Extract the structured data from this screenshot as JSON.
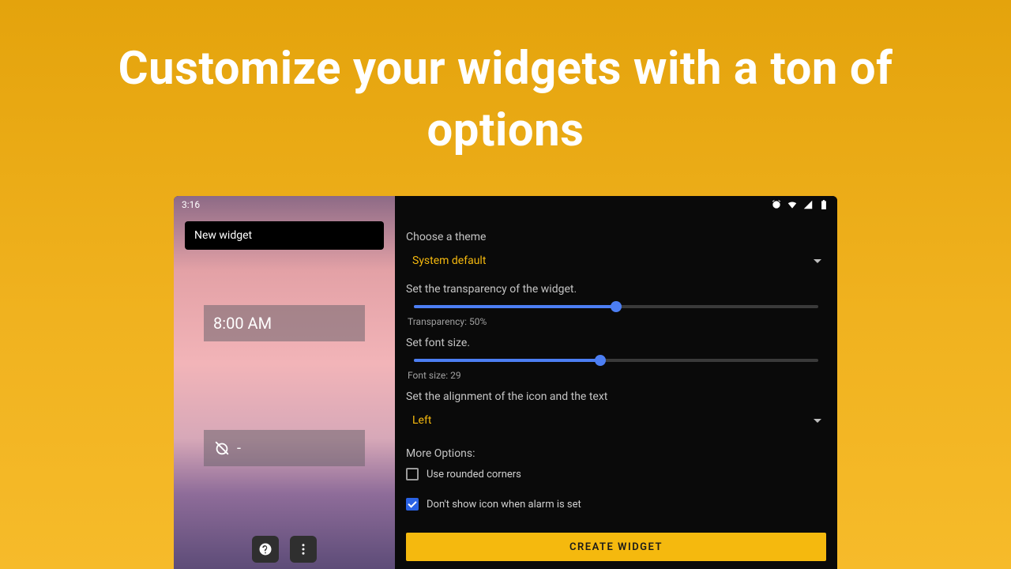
{
  "headline": "Customize your widgets with a ton of options",
  "status": {
    "time": "3:16"
  },
  "preview": {
    "name_value": "New widget",
    "widget_time": "8:00 AM",
    "widget_alt": "-"
  },
  "settings": {
    "theme_label": "Choose a theme",
    "theme_value": "System default",
    "transparency_label": "Set the transparency of the widget.",
    "transparency_pct": 50,
    "transparency_readout": "Transparency: 50%",
    "fontsize_label": "Set font size.",
    "fontsize_pct": 46,
    "fontsize_readout": "Font size: 29",
    "alignment_label": "Set the alignment of the icon and the text",
    "alignment_value": "Left",
    "more_label": "More Options:",
    "opt_rounded": "Use rounded corners",
    "opt_hideicon": "Don't show icon when alarm is set",
    "create_label": "CREATE WIDGET"
  }
}
